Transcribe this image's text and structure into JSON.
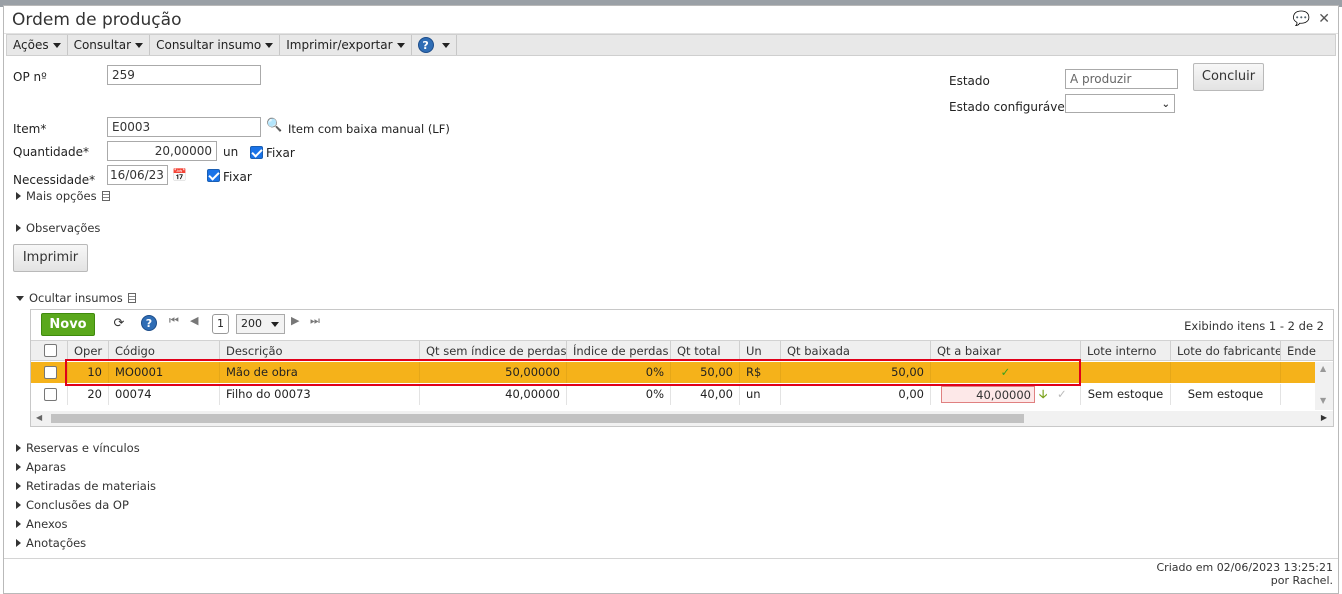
{
  "window": {
    "title": "Ordem de produção",
    "icons": [
      "chat-icon",
      "close-icon"
    ]
  },
  "menu": [
    "Ações",
    "Consultar",
    "Consultar insumo",
    "Imprimir/exportar"
  ],
  "form": {
    "op_label": "OP nº",
    "op_value": "259",
    "estado_label": "Estado",
    "estado_value": "A produzir",
    "concluir": "Concluir",
    "estado_conf_label": "Estado configurável",
    "estado_conf_value": "",
    "item_label": "Item*",
    "item_value": "E0003",
    "item_desc": "Item com baixa manual (LF)",
    "qtd_label": "Quantidade*",
    "qtd_value": "20,00000",
    "qtd_unit": "un",
    "fixar1": "Fixar",
    "nec_label": "Necessidade*",
    "nec_value": "16/06/23",
    "fixar2": "Fixar",
    "mais_opcoes": "Mais opções",
    "observacoes": "Observações",
    "imprimir": "Imprimir",
    "ocultar_insumos": "Ocultar insumos"
  },
  "grid": {
    "novo": "Novo",
    "page": "1",
    "per_page": "200",
    "exibindo": "Exibindo itens 1 - 2 de 2",
    "columns": [
      "Oper",
      "Código",
      "Descrição",
      "Qt sem índice de perdas",
      "Índice de perdas",
      "Qt total",
      "Un",
      "Qt baixada",
      "Qt a baixar",
      "Lote interno",
      "Lote do fabricante",
      "Ende"
    ],
    "rows": [
      {
        "oper": "10",
        "codigo": "MO0001",
        "descricao": "Mão de obra",
        "qt_sem": "50,00000",
        "indice": "0%",
        "qt_total": "50,00",
        "un": "R$",
        "qt_baixada": "50,00",
        "qt_a_baixar": "",
        "lote_interno": "",
        "lote_fab": "",
        "status": "done"
      },
      {
        "oper": "20",
        "codigo": "00074",
        "descricao": "Filho do 00073",
        "qt_sem": "40,00000",
        "indice": "0%",
        "qt_total": "40,00",
        "un": "un",
        "qt_baixada": "0,00",
        "qt_a_baixar": "40,00000",
        "lote_interno": "Sem estoque",
        "lote_fab": "Sem estoque",
        "status": "pending"
      }
    ]
  },
  "sections": [
    "Reservas e vínculos",
    "Aparas",
    "Retiradas de materiais",
    "Conclusões da OP",
    "Anexos",
    "Anotações"
  ],
  "footer": {
    "line1": "Criado em 02/06/2023 13:25:21",
    "line2": "por Rachel."
  },
  "colors": {
    "selected_row": "#f5b21a",
    "highlight_border": "#e0001a",
    "novo_button": "#5aa81c"
  }
}
